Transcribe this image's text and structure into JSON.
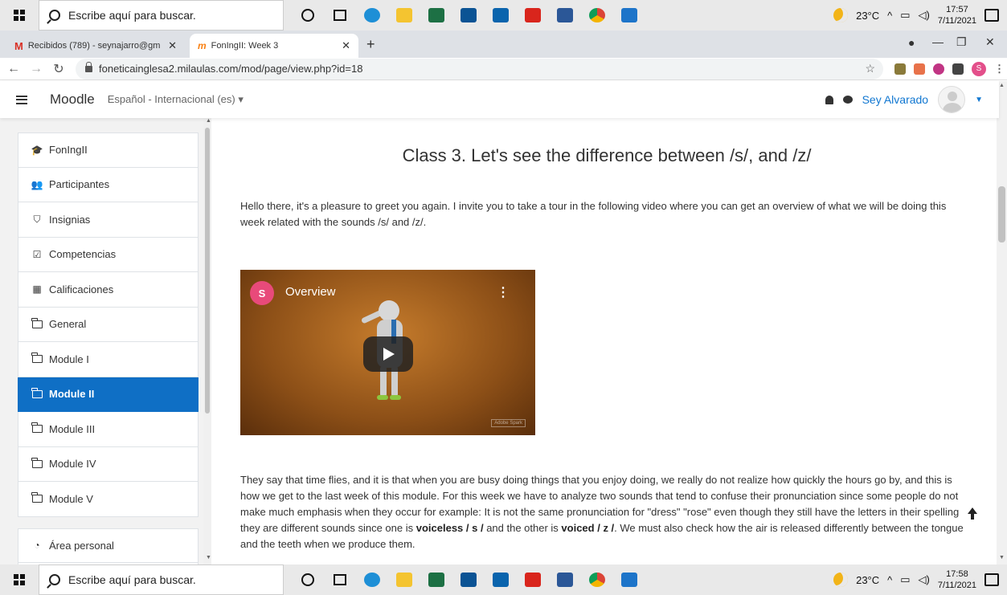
{
  "taskbar": {
    "search_placeholder": "Escribe aquí para buscar.",
    "weather": "23°C",
    "time_top": "17:57",
    "date_top": "7/11/2021",
    "time_bottom": "17:58",
    "date_bottom": "7/11/2021",
    "apps": [
      "edge-icon",
      "file-explorer-icon",
      "excel-icon",
      "store-icon",
      "mail-icon",
      "acrobat-icon",
      "word-icon",
      "chrome-icon",
      "photos-icon"
    ]
  },
  "browser": {
    "tabs": [
      {
        "title": "Recibidos (789) - seynajarro@gm",
        "icon": "gmail-icon"
      },
      {
        "title": "FonIngII: Week 3",
        "icon": "moodle-favicon"
      }
    ],
    "url": "foneticainglesa2.milaulas.com/mod/page/view.php?id=18"
  },
  "navbar": {
    "brand": "Moodle",
    "language": "Español - Internacional (es)",
    "user": "Sey Alvarado"
  },
  "drawer": {
    "group1": [
      {
        "label": "FonIngII",
        "icon": "graduation-cap-icon"
      },
      {
        "label": "Participantes",
        "icon": "users-icon"
      },
      {
        "label": "Insignias",
        "icon": "shield-icon"
      },
      {
        "label": "Competencias",
        "icon": "checkbox-icon"
      },
      {
        "label": "Calificaciones",
        "icon": "table-icon"
      },
      {
        "label": "General",
        "icon": "folder-icon"
      },
      {
        "label": "Module I",
        "icon": "folder-icon"
      },
      {
        "label": "Module II",
        "icon": "folder-icon"
      },
      {
        "label": "Module III",
        "icon": "folder-icon"
      },
      {
        "label": "Module IV",
        "icon": "folder-icon"
      },
      {
        "label": "Module V",
        "icon": "folder-icon"
      }
    ],
    "group2": [
      {
        "label": "Área personal",
        "icon": "dashboard-icon"
      }
    ],
    "active": "Module II"
  },
  "page": {
    "title": "Class 3. Let's see the difference between /s/, and /z/",
    "intro": "Hello there, it's a pleasure to greet you again. I invite you to take a tour in the following video where you can get an overview of what we will be doing this week related with the sounds /s/ and /z/.",
    "video": {
      "channel_initial": "S",
      "title": "Overview",
      "watermark": "Adobe Spark"
    },
    "body": {
      "part1": " They say that time flies, and it is that when you are busy doing things that you enjoy doing, we really do not realize how quickly the hours go by, and this is how we get to the last week of this module. For this week we have to analyze two sounds that tend to confuse their pronunciation since some people do not make much emphasis when they occur for example: It is not the same pronunciation for \"dress\" \"rose\" even though they still have the letters in their spelling they are different sounds since one is ",
      "bold1": "voiceless / s /",
      "part2": " and the other is ",
      "bold2": "voiced / z /",
      "part3": ". We must also check how the air is released differently between the tongue and the teeth when we produce them."
    }
  }
}
